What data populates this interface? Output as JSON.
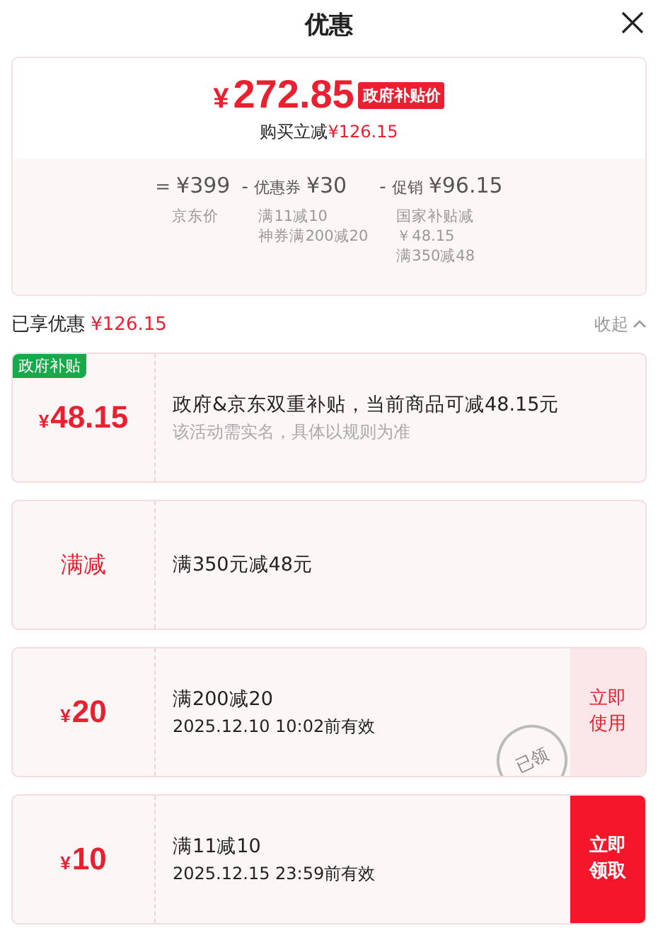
{
  "header": {
    "title": "优惠"
  },
  "summary": {
    "currency": "¥",
    "price": "272.85",
    "badge": "政府补贴价",
    "saving_label": "购买立减",
    "saving_amount": "¥126.15",
    "breakdown": [
      {
        "operator": "=",
        "amount": "¥399",
        "notes": [
          "京东价"
        ]
      },
      {
        "operator": "-",
        "label": "优惠券",
        "amount": "¥30",
        "notes": [
          "满11减10",
          "神券满200减20"
        ]
      },
      {
        "operator": "-",
        "label": "促销",
        "amount": "¥96.15",
        "notes": [
          "国家补贴减",
          "￥48.15",
          "满350减48"
        ]
      }
    ]
  },
  "enjoyed": {
    "label": "已享优惠",
    "amount": "¥126.15",
    "toggle": "收起",
    "expanded": true
  },
  "coupons": [
    {
      "kind": "amount",
      "tag": "政府补贴",
      "currency": "¥",
      "amount": "48.15",
      "title": "政府&京东双重补贴，当前商品可减48.15元",
      "note": "该活动需实名，具体以规则为准"
    },
    {
      "kind": "label",
      "label": "满减",
      "title": "满350元减48元"
    },
    {
      "kind": "amount",
      "currency": "¥",
      "amount": "20",
      "title": "满200减20",
      "note": "2025.12.10 10:02前有效",
      "action": "立即使用",
      "claimed": true,
      "stamp": "已领"
    },
    {
      "kind": "amount",
      "currency": "¥",
      "amount": "10",
      "title": "满11减10",
      "note": "2025.12.15 23:59前有效",
      "action": "立即领取",
      "claimed": false
    }
  ]
}
